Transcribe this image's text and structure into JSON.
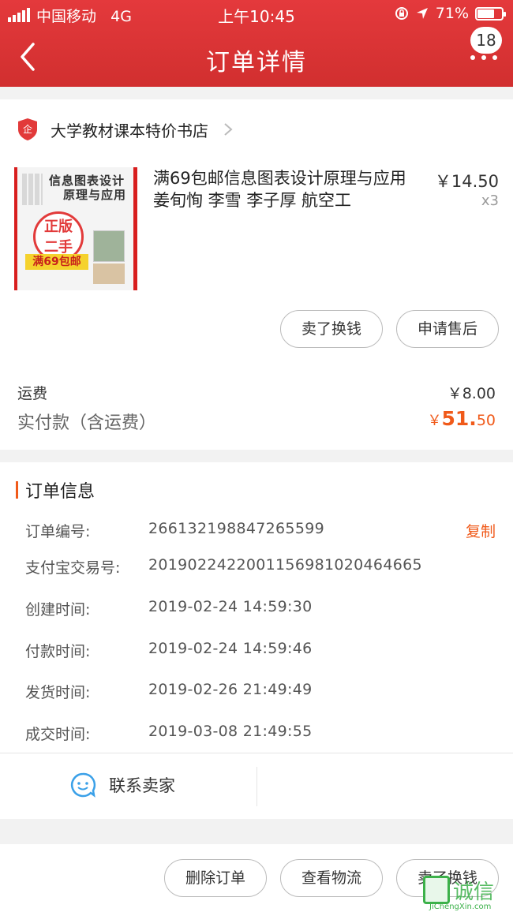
{
  "status_bar": {
    "carrier": "中国移动",
    "network": "4G",
    "time": "上午10:45",
    "battery": "71%",
    "battery_level": 0.71
  },
  "nav": {
    "title": "订单详情",
    "badge": "18"
  },
  "shop": {
    "name": "大学教材课本特价书店"
  },
  "item": {
    "title": "满69包邮信息图表设计原理与应用 姜旬恂 李雪 李子厚 航空工",
    "price": "￥14.50",
    "quantity": "x3",
    "thumb_text": {
      "line1": "信息图表设计",
      "line2": "原理与应用",
      "badge_line1": "正版",
      "badge_line2": "二手",
      "ribbon": "满69包邮"
    }
  },
  "actions": {
    "sell_label": "卖了换钱",
    "after_sale_label": "申请售后"
  },
  "summary": {
    "shipping_label": "运费",
    "shipping_value": "￥8.00",
    "paid_label": "实付款（含运费）",
    "paid_currency": "￥",
    "paid_int": "51.",
    "paid_dec": "50"
  },
  "order_info": {
    "title": "订单信息",
    "copy_label": "复制",
    "rows": [
      {
        "label": "订单编号:",
        "value": "266132198847265599"
      },
      {
        "label": "支付宝交易号:",
        "value": "2019022422001156981020464665"
      },
      {
        "label": "创建时间:",
        "value": "2019-02-24 14:59:30"
      },
      {
        "label": "付款时间:",
        "value": "2019-02-24 14:59:46"
      },
      {
        "label": "发货时间:",
        "value": "2019-02-26 21:49:49"
      },
      {
        "label": "成交时间:",
        "value": "2019-03-08 21:49:55"
      }
    ]
  },
  "contact": {
    "label": "联系卖家"
  },
  "bottom_actions": {
    "delete_label": "删除订单",
    "logistics_label": "查看物流",
    "sell_label": "卖了换钱"
  },
  "watermark": {
    "text": "诚信",
    "sub": "JiChengXin.com"
  },
  "colors": {
    "brand_red": "#d8302f",
    "accent_orange": "#f05a1a"
  }
}
